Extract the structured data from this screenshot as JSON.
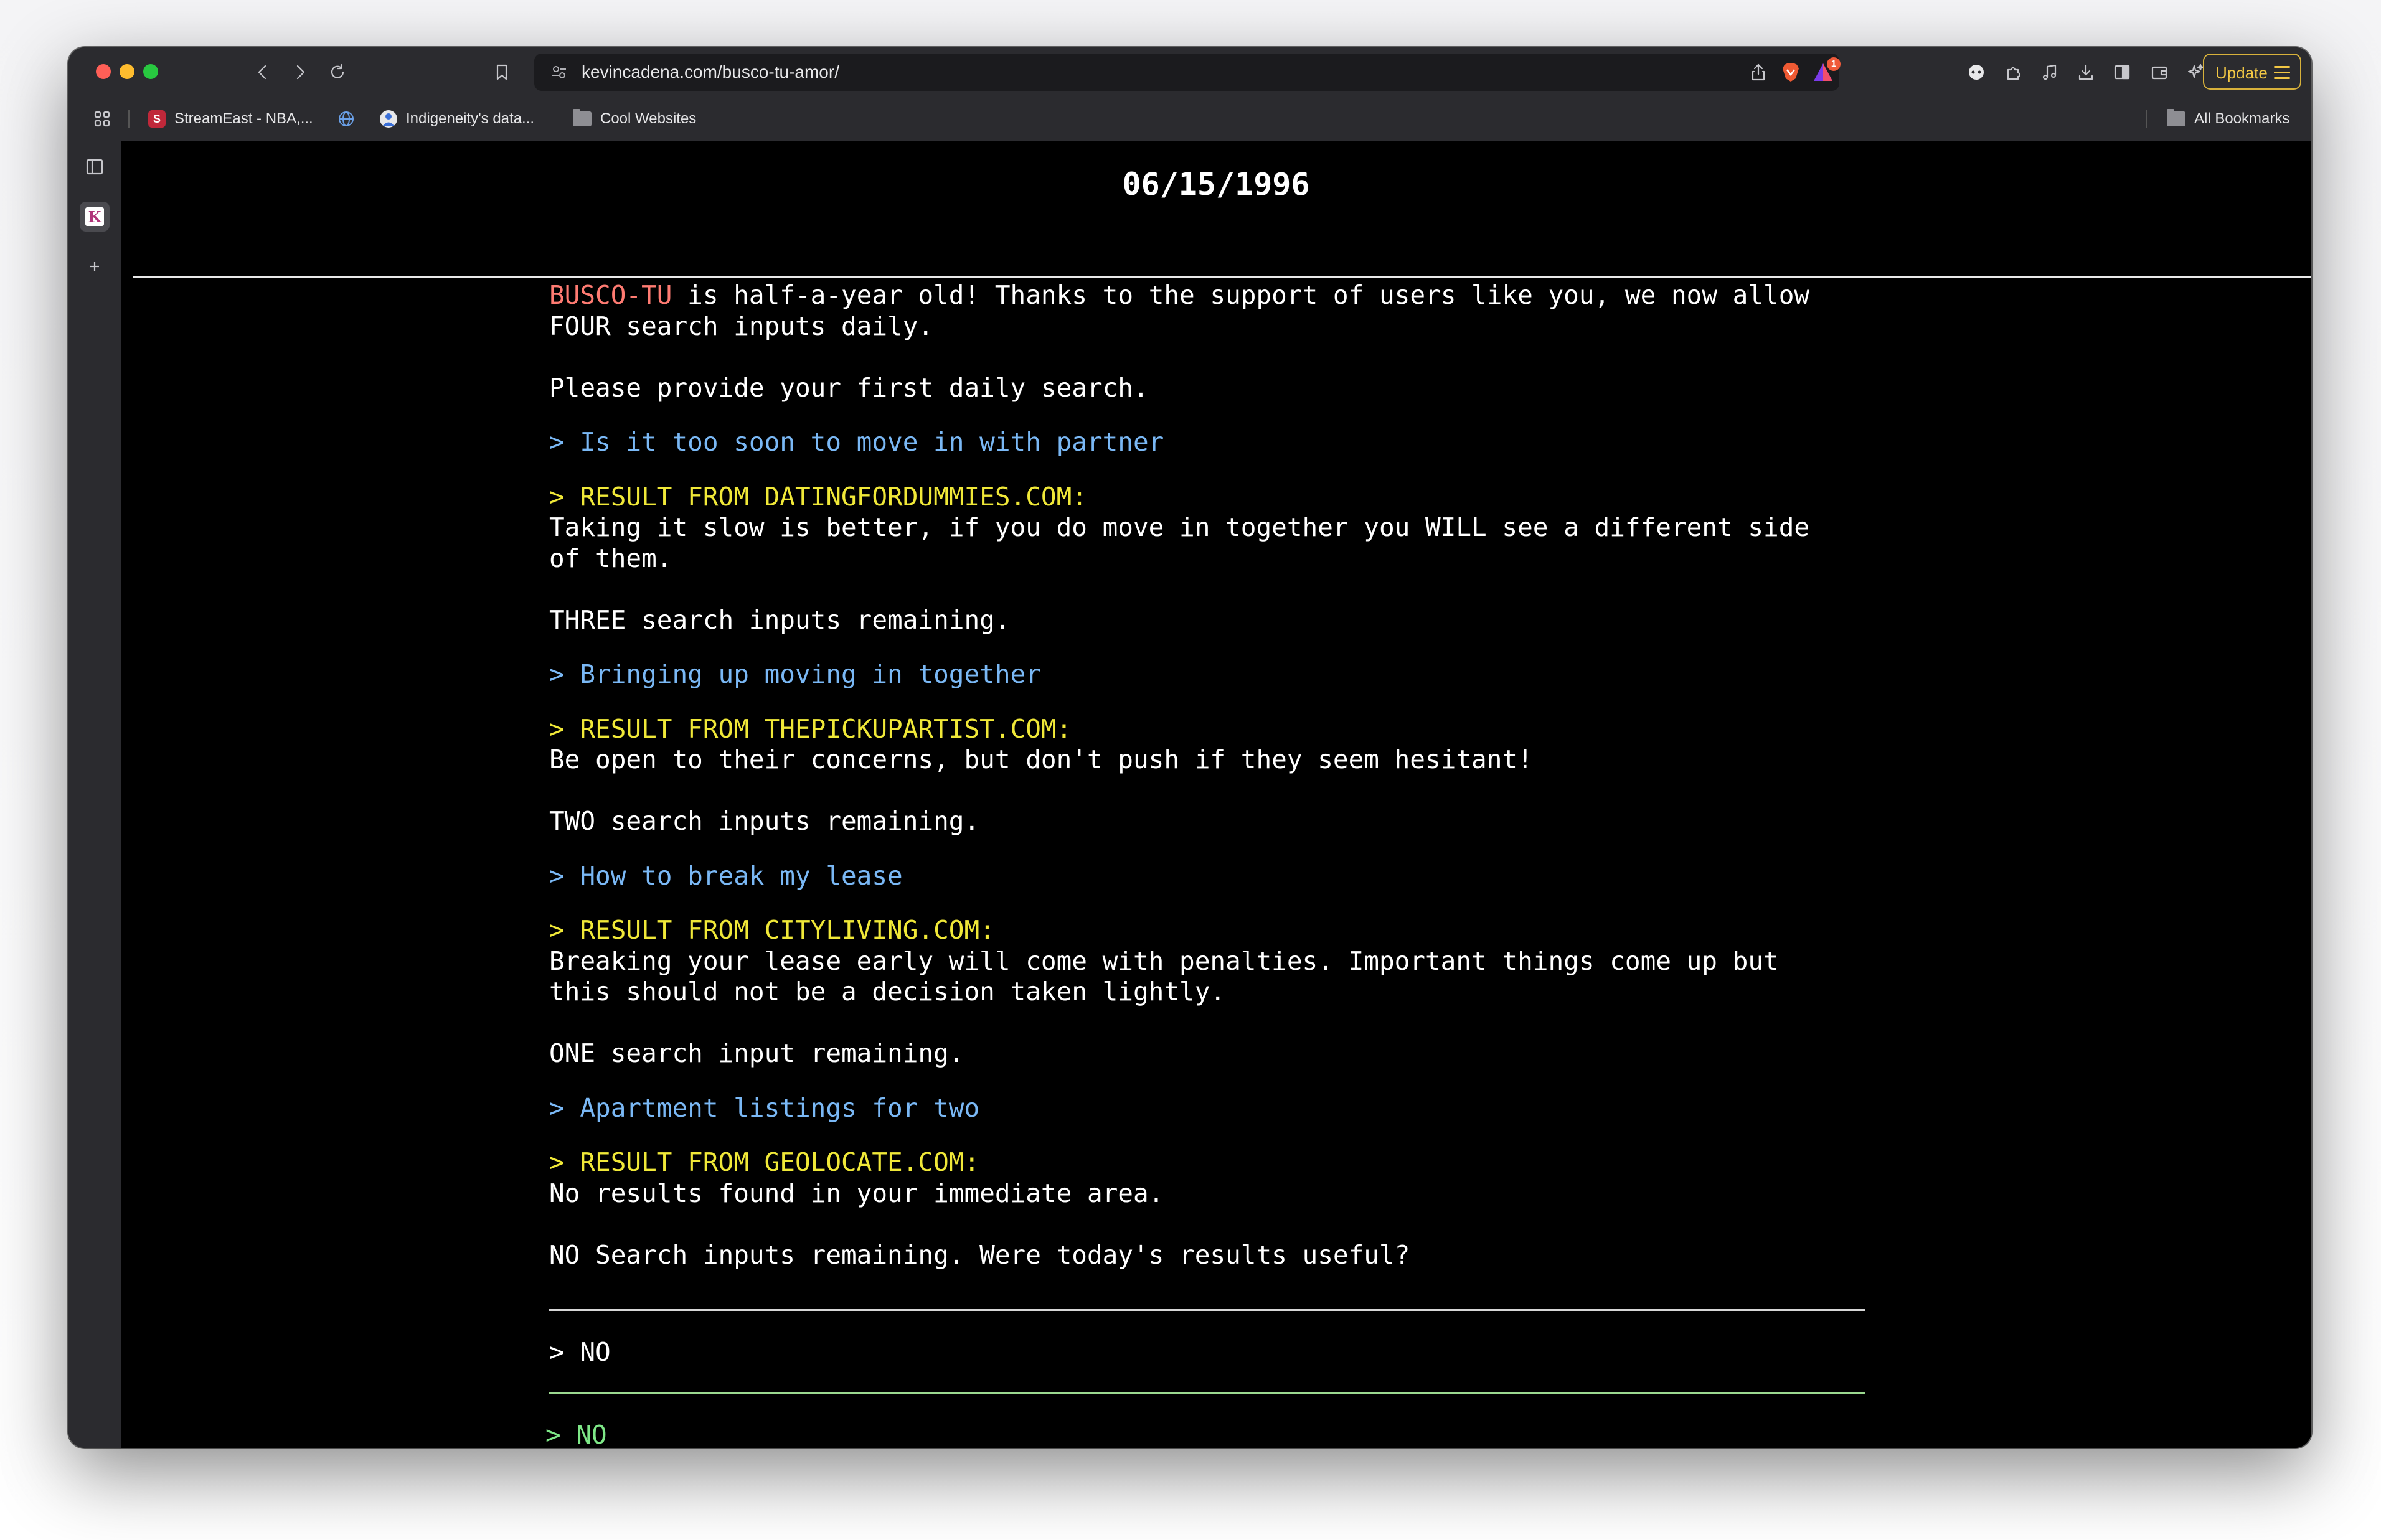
{
  "browser": {
    "url": "kevincadena.com/busco-tu-amor/",
    "update_label": "Update",
    "rewards_count": "1",
    "bookmarks": [
      {
        "label": "StreamEast - NBA,...",
        "favicon": "S"
      },
      {
        "label": "Indigeneity's data...",
        "favicon": "globe-person"
      },
      {
        "label": "Cool Websites",
        "favicon": "folder"
      }
    ],
    "all_bookmarks_label": "All Bookmarks"
  },
  "page": {
    "date": "06/15/1996",
    "intro_brand": "BUSCO-TU",
    "intro_rest": " is half-a-year old! Thanks to the support of users like you, we now allow",
    "intro_line2": "FOUR search inputs daily.",
    "prompt_first": "Please provide your first daily search.",
    "searches": [
      {
        "query": "> Is it too soon to move in with partner",
        "result_header": "> RESULT FROM DATINGFORDUMMIES.COM:",
        "result_lines": [
          "Taking it slow is better, if you do move in together you WILL see a different side",
          "of them."
        ],
        "remaining": "THREE search inputs remaining."
      },
      {
        "query": "> Bringing up moving in together",
        "result_header": "> RESULT FROM THEPICKUPARTIST.COM:",
        "result_lines": [
          "Be open to their concerns, but don't push if they seem hesitant!"
        ],
        "remaining": "TWO search inputs remaining."
      },
      {
        "query": "> How to break my lease",
        "result_header": "> RESULT FROM CITYLIVING.COM:",
        "result_lines": [
          "Breaking your lease early will come with penalties. Important things come up but",
          "this should not be a decision taken lightly."
        ],
        "remaining": "ONE search input remaining."
      },
      {
        "query": "> Apartment listings for two",
        "result_header": "> RESULT FROM GEOLOCATE.COM:",
        "result_lines": [
          "No results found in your immediate area."
        ],
        "remaining": "NO Search inputs remaining. Were today's results useful?"
      }
    ],
    "answer_option": "> NO",
    "answer_input": "> NO"
  },
  "colors": {
    "brand": "#ff7b72",
    "query": "#7ab8f5",
    "result_header": "#f0e838",
    "input_green": "#7ee787",
    "background": "#000000"
  }
}
